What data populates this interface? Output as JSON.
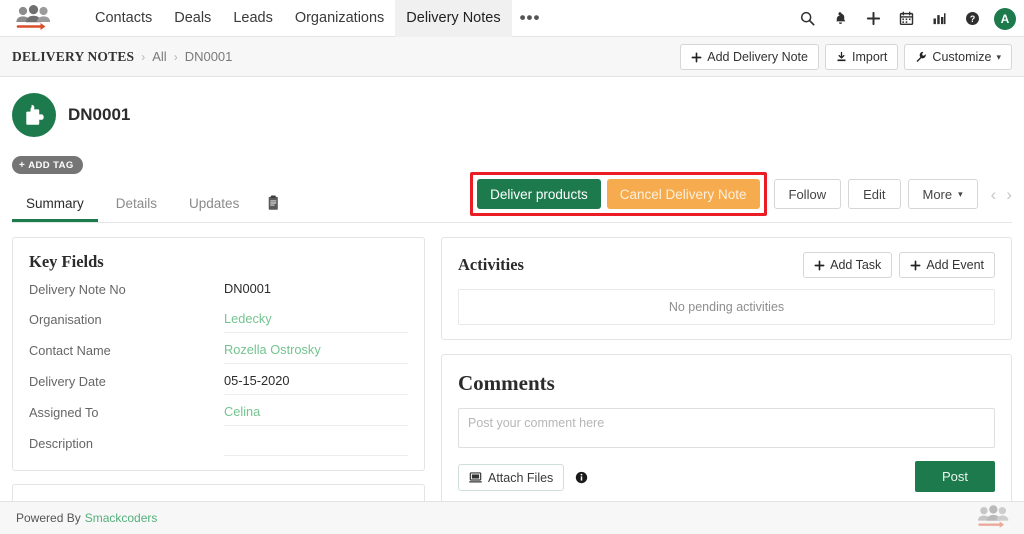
{
  "colors": {
    "brand_green": "#1d7a4d",
    "link_green": "#74c490",
    "warn_orange": "#f5ab4e",
    "highlight_red": "#ec1c24",
    "footer_link": "#54b07c"
  },
  "topnav": {
    "logo_icon": "people-group-arrow-logo",
    "items": [
      {
        "label": "Contacts",
        "active": false
      },
      {
        "label": "Deals",
        "active": false
      },
      {
        "label": "Leads",
        "active": false
      },
      {
        "label": "Organizations",
        "active": false
      },
      {
        "label": "Delivery Notes",
        "active": true
      }
    ],
    "overflow_label": "•••",
    "icons": [
      {
        "name": "search-icon"
      },
      {
        "name": "bell-icon"
      },
      {
        "name": "plus-icon"
      },
      {
        "name": "calendar-icon"
      },
      {
        "name": "chart-icon"
      },
      {
        "name": "help-icon"
      }
    ],
    "avatar_initial": "A"
  },
  "breadcrumb": {
    "root": "DELIVERY NOTES",
    "separator": "›",
    "middle": "All",
    "current": "DN0001",
    "actions": [
      {
        "label": "Add Delivery Note",
        "icon": "plus-icon"
      },
      {
        "label": "Import",
        "icon": "download-icon"
      },
      {
        "label": "Customize",
        "icon": "wrench-icon",
        "caret": "▾"
      }
    ]
  },
  "record": {
    "avatar_icon": "puzzle-piece-icon",
    "title": "DN0001",
    "add_tag_label": "ADD TAG",
    "add_tag_plus": "+",
    "actions": {
      "highlighted": [
        {
          "label": "Deliver products",
          "style": "primary"
        },
        {
          "label": "Cancel Delivery Note",
          "style": "warning"
        }
      ],
      "follow_label": "Follow",
      "edit_label": "Edit",
      "more_label": "More",
      "more_caret": "▾",
      "prev_arrow": "‹",
      "next_arrow": "›"
    }
  },
  "tabs": [
    {
      "label": "Summary",
      "active": true
    },
    {
      "label": "Details",
      "active": false
    },
    {
      "label": "Updates",
      "active": false
    }
  ],
  "tab_icon": "clipboard-notes-icon",
  "key_fields": {
    "title": "Key Fields",
    "rows": [
      {
        "label": "Delivery Note No",
        "value": "DN0001",
        "type": "text"
      },
      {
        "label": "Organisation",
        "value": "Ledecky",
        "type": "link"
      },
      {
        "label": "Contact Name",
        "value": "Rozella Ostrosky",
        "type": "link"
      },
      {
        "label": "Delivery Date",
        "value": "05-15-2020",
        "type": "text"
      },
      {
        "label": "Assigned To",
        "value": "Celina",
        "type": "link"
      },
      {
        "label": "Description",
        "value": "",
        "type": "text"
      }
    ]
  },
  "partial_card": {
    "label": "",
    "visible": true
  },
  "activities": {
    "title": "Activities",
    "add_task_label": "Add Task",
    "add_event_label": "Add Event",
    "add_icon": "plus-icon",
    "empty_text": "No pending activities"
  },
  "comments": {
    "title": "Comments",
    "input_value": "",
    "input_placeholder": "Post your comment here",
    "attach_label": "Attach Files",
    "attach_icon": "monitor-icon",
    "info_icon": "info-circle-icon",
    "post_label": "Post"
  },
  "footer": {
    "powered_by": "Powered By",
    "brand": "Smackcoders",
    "logo_icon": "people-group-arrow-logo"
  }
}
